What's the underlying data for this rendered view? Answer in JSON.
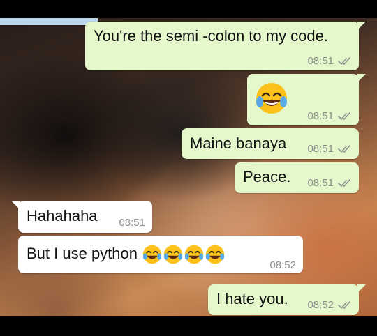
{
  "messages": [
    {
      "id": "m1",
      "text": "You're the semi -colon to my code.",
      "time": "08:51",
      "direction": "outgoing"
    },
    {
      "id": "m2",
      "emoji": "face-with-tears-of-joy",
      "time": "08:51",
      "direction": "outgoing"
    },
    {
      "id": "m3",
      "text": "Maine banaya",
      "time": "08:51",
      "direction": "outgoing"
    },
    {
      "id": "m4",
      "text": "Peace.",
      "time": "08:51",
      "direction": "outgoing"
    },
    {
      "id": "m5",
      "text": "Hahahaha",
      "time": "08:51",
      "direction": "incoming"
    },
    {
      "id": "m6",
      "text": "But I use python",
      "emoji": "face-with-tears-of-joy",
      "emoji_count": 4,
      "time": "08:52",
      "direction": "incoming"
    },
    {
      "id": "m7",
      "text": "I hate you.",
      "time": "08:52",
      "direction": "outgoing"
    }
  ],
  "colors": {
    "outgoing_bubble": "#e4f8cc",
    "incoming_bubble": "#ffffff",
    "meta_text": "#8a8f8a"
  },
  "icons": {
    "read_receipt": "double-check-icon",
    "emoji": "face-with-tears-of-joy-icon"
  }
}
